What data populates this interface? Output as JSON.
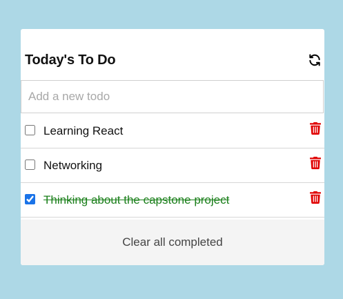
{
  "app": {
    "title": "Today's To Do",
    "refresh_icon": "refresh-icon"
  },
  "new_todo": {
    "placeholder": "Add a new todo",
    "value": ""
  },
  "todos": [
    {
      "label": "Learning React",
      "completed": false,
      "delete_icon": "trash-icon"
    },
    {
      "label": "Networking",
      "completed": false,
      "delete_icon": "trash-icon"
    },
    {
      "label": "Thinking about the capstone project",
      "completed": true,
      "delete_icon": "trash-icon"
    }
  ],
  "footer": {
    "clear_label": "Clear all completed"
  },
  "colors": {
    "background": "#add8e6",
    "completed_text": "#1a7f1a",
    "delete_icon": "#e00000",
    "footer_bg": "#f4f4f4"
  }
}
